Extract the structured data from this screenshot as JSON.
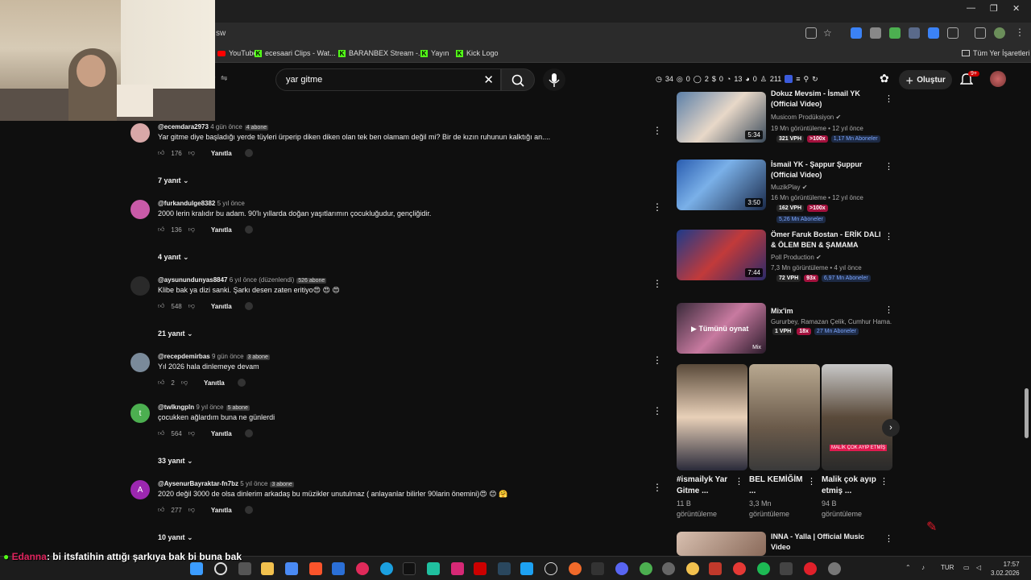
{
  "browser": {
    "url_fragment": "sw",
    "bookmarks": [
      {
        "label": "YouTube",
        "icon": "youtube-icon"
      },
      {
        "label": "ecesaari Clips - Wat...",
        "icon": "kick-icon"
      },
      {
        "label": "BARANBEX Stream -...",
        "icon": "kick-icon"
      },
      {
        "label": "Yayın",
        "icon": "kick-icon"
      },
      {
        "label": "Kick Logo",
        "icon": "kick-icon"
      }
    ],
    "all_bookmarks": "Tüm Yer İşaretleri"
  },
  "youtube": {
    "search_value": "yar gitme",
    "filter_fragment": "r",
    "stats": [
      "34",
      "0",
      "2",
      "0",
      "13",
      "0",
      "211"
    ],
    "create_label": "Oluştur",
    "notifications": "9+"
  },
  "comments": [
    {
      "user": "@ecemdara2973",
      "time": "4 gün önce",
      "badge": "4 abone",
      "text": "Yar gitme diye başladığı yerde tüyleri ürperip diken diken olan tek ben olamam değil mi? Bir de kızın ruhunun kalktığı an....",
      "likes": "176",
      "reply": "Yanıtla",
      "replies": "7 yanıt",
      "avatar_color": "#d8a8a8"
    },
    {
      "user": "@furkandulge8382",
      "time": "5 yıl önce",
      "badge": "",
      "text": "2000 lerin kralıdır bu adam. 90'lı yıllarda doğan yaşıtlarımın çocukluğudur, gençliğidir.",
      "likes": "136",
      "reply": "Yanıtla",
      "replies": "4 yanıt",
      "avatar_color": "#c95aa8"
    },
    {
      "user": "@aysunundunyas8847",
      "time": "6 yıl önce (düzenlendi)",
      "badge": "526 abone",
      "text": "Klibe bak ya dizi sanki. Şarkı desen zaten eritiyo😍 😍 😍",
      "likes": "548",
      "reply": "Yanıtla",
      "replies": "21 yanıt",
      "avatar_color": "#2a2a2a"
    },
    {
      "user": "@recepdemirbas",
      "time": "9 gün önce",
      "badge": "3 abone",
      "text": "Yıl 2026 hala dinlemeye devam",
      "likes": "2",
      "reply": "Yanıtla",
      "replies": "",
      "avatar_color": "#7a8a9a"
    },
    {
      "user": "@twlkngpln",
      "time": "9 yıl önce",
      "badge": "5 abone",
      "text": "çocukken ağlardım buna ne günlerdi",
      "likes": "564",
      "reply": "Yanıtla",
      "replies": "33 yanıt",
      "avatar_color": "#4caf50",
      "initial": "t"
    },
    {
      "user": "@AysenurBayraktar-fn7bz",
      "time": "5 yıl önce",
      "badge": "3 abone",
      "text": "2020 değil 3000 de olsa dinlerim arkadaş bu müzikler unutulmaz ( anlayanlar bilirler  90larin önemini)😍 😊 🤗",
      "likes": "277",
      "reply": "Yanıtla",
      "replies": "10 yanıt",
      "avatar_color": "#9c27b0",
      "initial": "A"
    }
  ],
  "videos": [
    {
      "title": "Dokuz Mevsim - İsmail YK (Official Video)",
      "channel": "Musicom Prodüksiyon",
      "meta": "19 Mn görüntüleme • 12 yıl önce",
      "duration": "5:34",
      "vph": "321 VPH",
      "ratio": ">100x",
      "subs": "1,17 Mn Aboneler"
    },
    {
      "title": "İsmail YK - Şappur Şuppur (Official Video)",
      "channel": "MuzikPlay",
      "meta": "16 Mn görüntüleme • 12 yıl önce",
      "duration": "3:50",
      "vph": "162 VPH",
      "ratio": ">100x",
      "subs": "5,26 Mn Aboneler"
    },
    {
      "title": "Ömer Faruk Bostan - ERİK DALI & ÖLEM BEN & ŞAMAMA",
      "channel": "Poll Production",
      "meta": "7,3 Mn görüntüleme • 4 yıl önce",
      "duration": "7:44",
      "vph": "72 VPH",
      "ratio": "93x",
      "subs": "6,97 Mn Aboneler"
    },
    {
      "title": "Mix'im",
      "channel": "Gururbey, Ramazan Çelik, Cumhur Hama...",
      "meta": "",
      "duration": "",
      "vph": "1 VPH",
      "ratio": "18x",
      "subs": "27 Mn Aboneler",
      "overlay": "Tümünü oynat",
      "mix": "Mix"
    }
  ],
  "shorts": [
    {
      "title": "#ismailyk Yar Gitme ...",
      "views": "11 B görüntüleme"
    },
    {
      "title": "BEL KEMİĞİM ...",
      "views": "3,3 Mn görüntüleme"
    },
    {
      "title": "Malik çok ayıp etmiş ...",
      "views": "94 B görüntüleme",
      "caption": "MALİK ÇOK AYIP ETMİŞ"
    }
  ],
  "next_video": {
    "title": "INNA - Yalla | Official Music Video"
  },
  "chat": {
    "user": "Edanna",
    "message": ": bi itsfatihin attığı şarkıya bak bi buna bak"
  },
  "taskbar": {
    "lang": "TUR",
    "time": "17:57",
    "date": "3.02.2026"
  }
}
